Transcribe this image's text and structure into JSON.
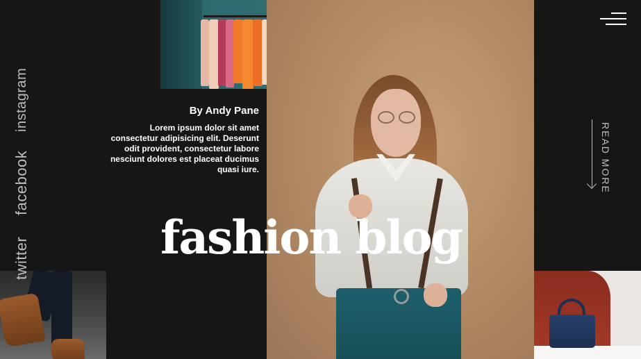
{
  "hero": {
    "author": "By Andy Pane",
    "excerpt": "Lorem ipsum dolor sit amet consectetur adipisicing elit. Deserunt odit provident, consectetur labore nesciunt dolores est placeat ducimus quasi iure.",
    "title": "fashion blog"
  },
  "social": {
    "instagram": "instagram",
    "facebook": "facebook",
    "twitter": "twitter"
  },
  "cta": {
    "read_more": "READ MORE"
  },
  "icons": {
    "menu": "hamburger-menu-icon",
    "arrow": "arrow-down-icon"
  },
  "colors": {
    "background": "#161616",
    "text": "#ffffff",
    "muted": "#bdbdbd"
  }
}
